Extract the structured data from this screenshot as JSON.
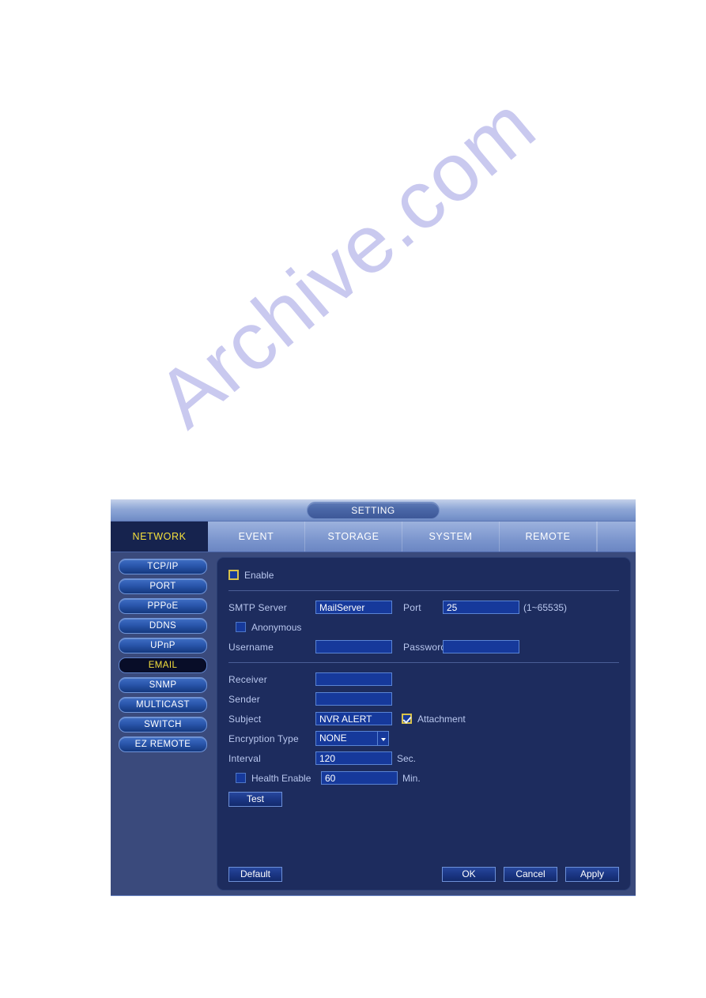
{
  "watermark": {
    "text": "Archive.com"
  },
  "window": {
    "title": "SETTING",
    "tabs": [
      {
        "label": "NETWORK",
        "active": true
      },
      {
        "label": "EVENT",
        "active": false
      },
      {
        "label": "STORAGE",
        "active": false
      },
      {
        "label": "SYSTEM",
        "active": false
      },
      {
        "label": "REMOTE",
        "active": false
      }
    ]
  },
  "sidebar": {
    "items": [
      {
        "label": "TCP/IP",
        "selected": false
      },
      {
        "label": "PORT",
        "selected": false
      },
      {
        "label": "PPPoE",
        "selected": false
      },
      {
        "label": "DDNS",
        "selected": false
      },
      {
        "label": "UPnP",
        "selected": false
      },
      {
        "label": "EMAIL",
        "selected": true
      },
      {
        "label": "SNMP",
        "selected": false
      },
      {
        "label": "MULTICAST",
        "selected": false
      },
      {
        "label": "SWITCH",
        "selected": false
      },
      {
        "label": "EZ REMOTE",
        "selected": false
      }
    ]
  },
  "form": {
    "enable": {
      "label": "Enable",
      "checked": false,
      "focused": true
    },
    "smtp_server": {
      "label": "SMTP Server",
      "value": "MailServer"
    },
    "port": {
      "label": "Port",
      "value": "25",
      "hint": "(1~65535)"
    },
    "anonymous": {
      "label": "Anonymous",
      "checked": false
    },
    "username": {
      "label": "Username",
      "value": ""
    },
    "password": {
      "label": "Password",
      "value": ""
    },
    "receiver": {
      "label": "Receiver",
      "value": ""
    },
    "sender": {
      "label": "Sender",
      "value": ""
    },
    "subject": {
      "label": "Subject",
      "value": "NVR ALERT"
    },
    "attachment": {
      "label": "Attachment",
      "checked": true,
      "focused": true
    },
    "encryption_type": {
      "label": "Encryption Type",
      "value": "NONE"
    },
    "interval": {
      "label": "Interval",
      "value": "120",
      "unit": "Sec."
    },
    "health_enable": {
      "label": "Health Enable",
      "checked": false,
      "value": "60",
      "unit": "Min."
    },
    "test_button": "Test"
  },
  "footer": {
    "default_label": "Default",
    "ok_label": "OK",
    "cancel_label": "Cancel",
    "apply_label": "Apply"
  },
  "colors": {
    "accent_yellow": "#f5e03c",
    "panel_navy": "#1d2c5e",
    "sidebar_blue": "#3a4a7c",
    "input_blue": "#16399b",
    "focus_gold": "#d8c24a"
  }
}
